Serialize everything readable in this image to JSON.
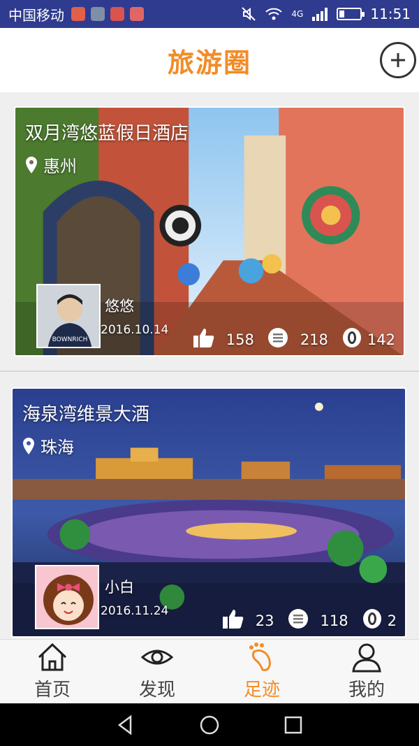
{
  "status_bar": {
    "carrier": "中国移动",
    "network": "4G",
    "time": "11:51",
    "battery_level": 0.25
  },
  "header": {
    "title": "旅游圈",
    "add_icon": "plus-circle-icon"
  },
  "posts": [
    {
      "title": "双月湾悠蓝假日酒店",
      "location": "惠州",
      "user": "悠悠",
      "date": "2016.10.14",
      "likes": "158",
      "comments": "218",
      "views": "142"
    },
    {
      "title": "海泉湾维景大酒",
      "location": "珠海",
      "user": "小白",
      "date": "2016.11.24",
      "likes": "23",
      "comments": "118",
      "views": "2"
    }
  ],
  "tabs": [
    {
      "label": "首页",
      "icon": "home-icon"
    },
    {
      "label": "发现",
      "icon": "eye-icon"
    },
    {
      "label": "足迹",
      "icon": "footprint-icon",
      "active": true
    },
    {
      "label": "我的",
      "icon": "user-icon"
    }
  ],
  "colors": {
    "accent": "#f28c28",
    "status_bar": "#2f3b8f"
  }
}
